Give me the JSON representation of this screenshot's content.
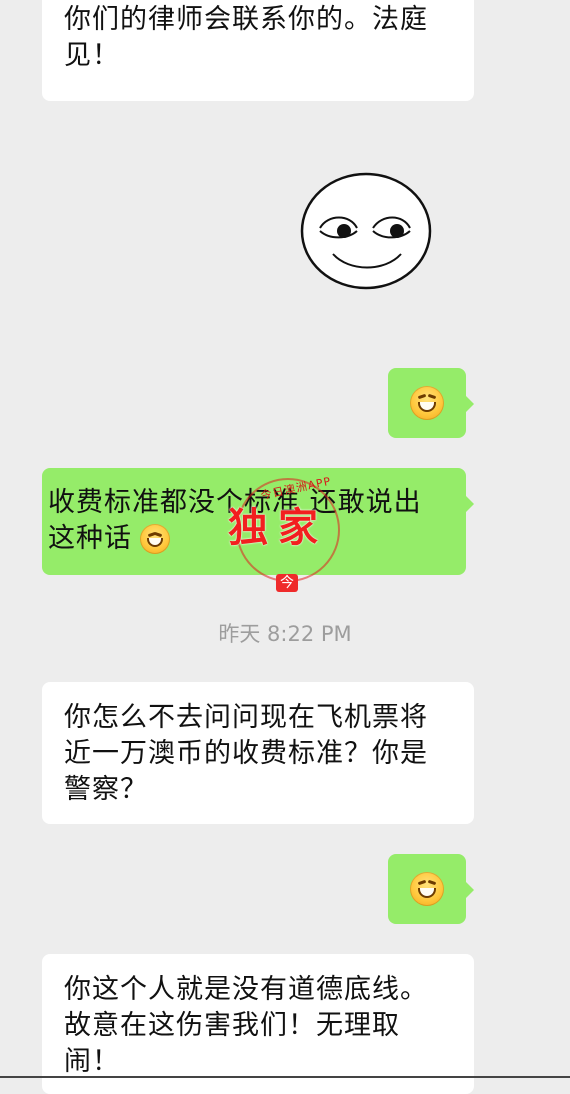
{
  "messages": {
    "m1": "你们的律师会联系你的。法庭\n见！",
    "m2": "收费标准都没个标准 还敢说出\n这种话",
    "m3": "你怎么不去问问现在飞机票将\n近一万澳币的收费标准？你是\n警察？",
    "m4": "你这个人就是没有道德底线。\n故意在这伤害我们！无理取\n闹！"
  },
  "timestamp": "昨天 8:22 PM",
  "watermark": {
    "main": "独家",
    "arc": "今日澳洲APP",
    "badge": "今"
  },
  "colors": {
    "background": "#ededed",
    "incoming": "#ffffff",
    "outgoing": "#95ec69",
    "watermark": "#f21f1f"
  },
  "icons": {
    "sticker": "smug-face-sticker",
    "emoji": "grinning-face-emoji"
  }
}
